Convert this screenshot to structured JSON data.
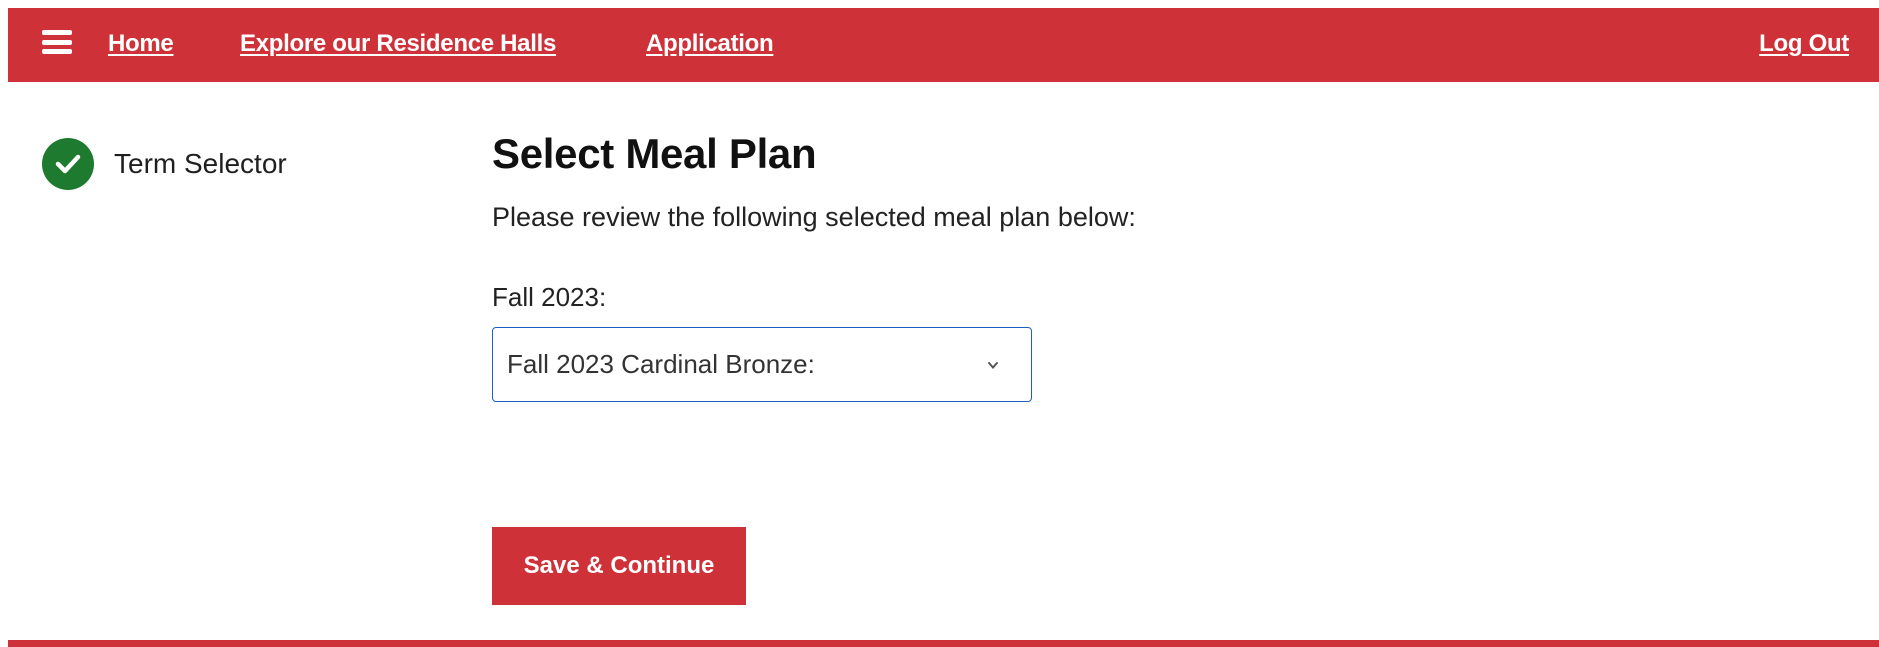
{
  "nav": {
    "home": "Home",
    "explore": "Explore our Residence Halls",
    "application": "Application",
    "logout": "Log Out"
  },
  "sidebar": {
    "steps": [
      {
        "label": "Term Selector",
        "status": "complete",
        "icon": "check-icon"
      }
    ]
  },
  "main": {
    "title": "Select Meal Plan",
    "intro": "Please review the following selected meal plan below:",
    "term_label": "Fall 2023:",
    "meal_plan_select": {
      "value": "Fall 2023 Cardinal Bronze:"
    },
    "save_label": "Save & Continue"
  },
  "colors": {
    "brand": "#cf3138",
    "success": "#1d7a2e",
    "focus": "#1f5fbf"
  }
}
